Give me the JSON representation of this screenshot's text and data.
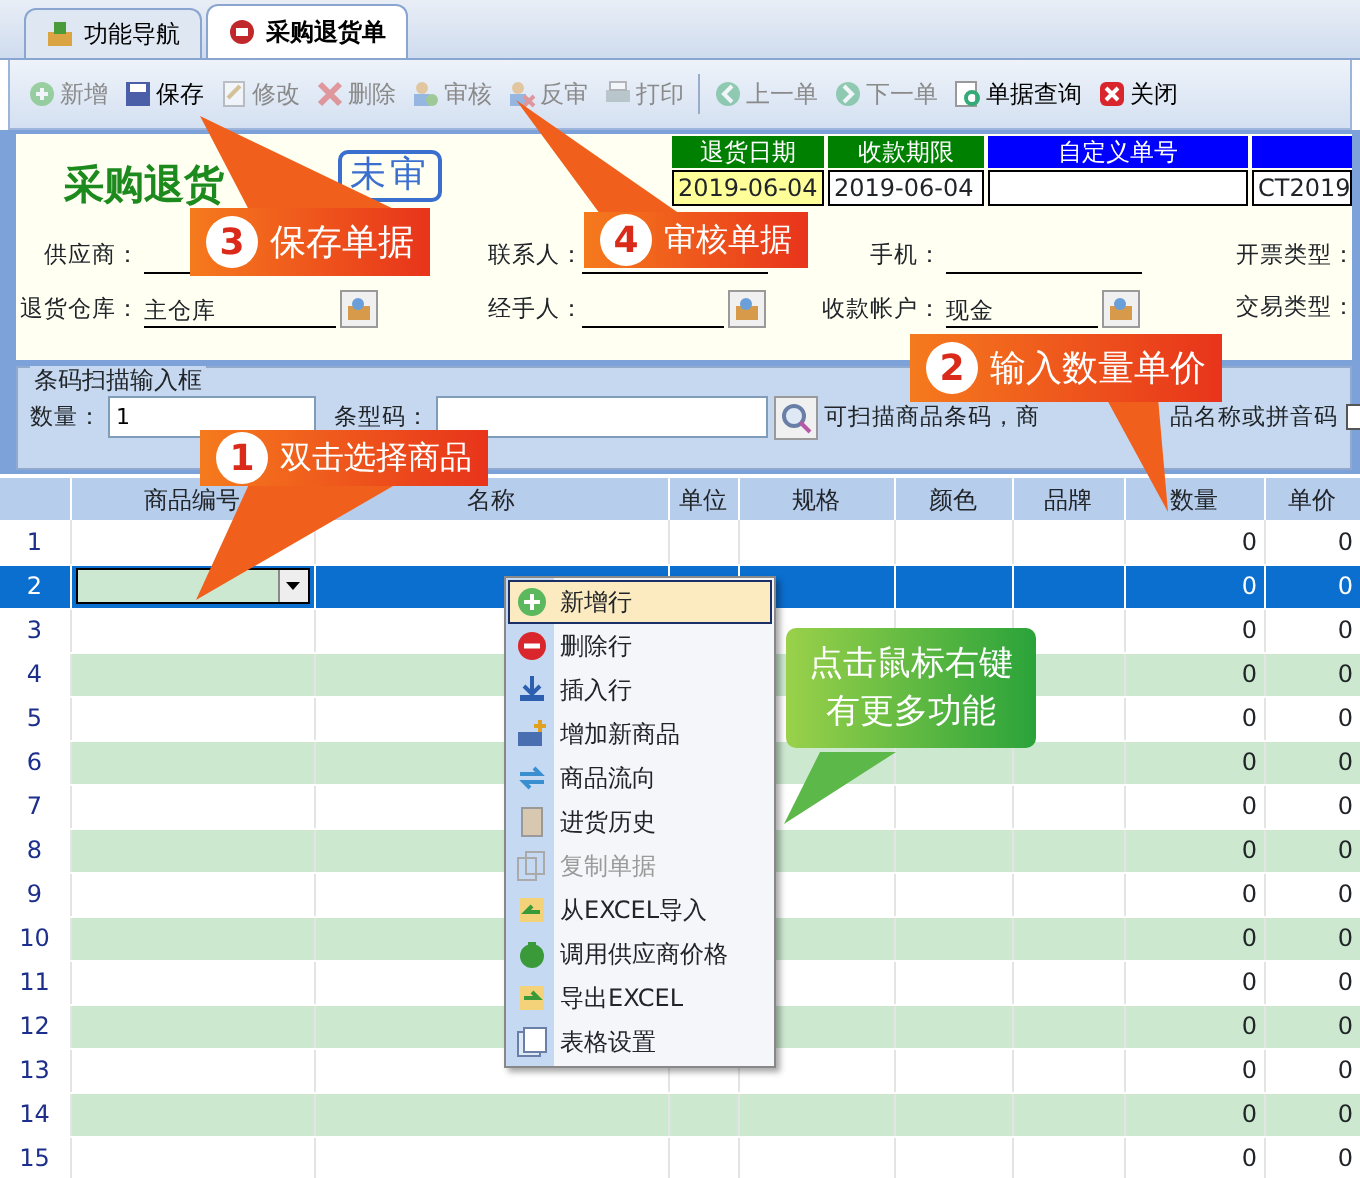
{
  "tabs": [
    {
      "label": "功能导航",
      "selected": false
    },
    {
      "label": "采购退货单",
      "selected": true
    }
  ],
  "toolbar": [
    {
      "label": "新增",
      "disabled": true
    },
    {
      "label": "保存",
      "disabled": false
    },
    {
      "label": "修改",
      "disabled": true
    },
    {
      "label": "删除",
      "disabled": true
    },
    {
      "label": "审核",
      "disabled": true
    },
    {
      "label": "反审",
      "disabled": true
    },
    {
      "label": "打印",
      "disabled": true
    },
    {
      "label": "上一单",
      "disabled": true
    },
    {
      "label": "下一单",
      "disabled": true
    },
    {
      "label": "单据查询",
      "disabled": false
    },
    {
      "label": "关闭",
      "disabled": false
    }
  ],
  "form": {
    "title": "采购退货",
    "stamp": "未审",
    "dates": [
      {
        "label": "退货日期",
        "value": "2019-06-04",
        "color": "#008000",
        "highlighted": true
      },
      {
        "label": "收款期限",
        "value": "2019-06-04",
        "color": "#008000",
        "highlighted": false
      },
      {
        "label": "自定义单号",
        "color": "#0000ff",
        "highlighted": false
      },
      {
        "value": "CT2019",
        "color": "#0000ff",
        "highlighted": false
      }
    ],
    "fields": [
      {
        "label": "供应商：",
        "kind": "text"
      },
      {
        "label": "联系人：",
        "kind": "text"
      },
      {
        "label": "手机：",
        "kind": "text"
      },
      {
        "label": "开票类型：",
        "kind": "label"
      },
      {
        "label": "退货仓库：",
        "value": "主仓库",
        "kind": "lookup"
      },
      {
        "label": "经手人：",
        "kind": "lookup"
      },
      {
        "label": "收款帐户：",
        "value": "现金",
        "kind": "lookup"
      },
      {
        "label": "交易类型：",
        "kind": "label"
      }
    ]
  },
  "barcode": {
    "legend": "条码扫描输入框",
    "quantity_label": "数量：",
    "quantity": "1",
    "barcode_label": "条型码：",
    "hint_parts": [
      "可扫描商品条码，商",
      "品名称或拼音码"
    ],
    "option_checked": false
  },
  "grid": {
    "columns": [
      "商品编号",
      "名称",
      "单位",
      "规格",
      "颜色",
      "品牌",
      "数量",
      "单价"
    ],
    "rows": [
      {
        "number": "1",
        "quantity": "0",
        "price": "0",
        "selected": false
      },
      {
        "number": "2",
        "quantity": "0",
        "price": "0",
        "selected": true
      },
      {
        "number": "3",
        "quantity": "0",
        "price": "0",
        "selected": false
      },
      {
        "number": "4",
        "quantity": "0",
        "price": "0",
        "selected": false
      },
      {
        "number": "5",
        "quantity": "0",
        "price": "0",
        "selected": false
      },
      {
        "number": "6",
        "quantity": "0",
        "price": "0",
        "selected": false
      },
      {
        "number": "7",
        "quantity": "0",
        "price": "0",
        "selected": false
      },
      {
        "number": "8",
        "quantity": "0",
        "price": "0",
        "selected": false
      },
      {
        "number": "9",
        "quantity": "0",
        "price": "0",
        "selected": false
      },
      {
        "number": "10",
        "quantity": "0",
        "price": "0",
        "selected": false
      },
      {
        "number": "11",
        "quantity": "0",
        "price": "0",
        "selected": false
      },
      {
        "number": "12",
        "quantity": "0",
        "price": "0",
        "selected": false
      },
      {
        "number": "13",
        "quantity": "0",
        "price": "0",
        "selected": false
      },
      {
        "number": "14",
        "quantity": "0",
        "price": "0",
        "selected": false
      },
      {
        "number": "15",
        "quantity": "0",
        "price": "0",
        "selected": false
      }
    ]
  },
  "context_menu": [
    {
      "label": "新增行",
      "selected": true,
      "disabled": false
    },
    {
      "label": "删除行",
      "selected": false,
      "disabled": false
    },
    {
      "label": "插入行",
      "selected": false,
      "disabled": false
    },
    {
      "label": "增加新商品",
      "selected": false,
      "disabled": false
    },
    {
      "label": "商品流向",
      "selected": false,
      "disabled": false
    },
    {
      "label": "进货历史",
      "selected": false,
      "disabled": false
    },
    {
      "label": "复制单据",
      "selected": false,
      "disabled": true
    },
    {
      "label": "从EXCEL导入",
      "selected": false,
      "disabled": false
    },
    {
      "label": "调用供应商价格",
      "selected": false,
      "disabled": false
    },
    {
      "label": "导出EXCEL",
      "selected": false,
      "disabled": false
    },
    {
      "label": "表格设置",
      "selected": false,
      "disabled": false
    }
  ],
  "callouts": [
    {
      "kind": "step",
      "number": "3",
      "text": "保存单据"
    },
    {
      "kind": "step",
      "number": "4",
      "text": "审核单据"
    },
    {
      "kind": "step",
      "number": "2",
      "text": "输入数量单价"
    },
    {
      "kind": "step",
      "number": "1",
      "text": "双击选择商品"
    },
    {
      "kind": "note",
      "text": "点击鼠标右键有更多功能"
    }
  ]
}
